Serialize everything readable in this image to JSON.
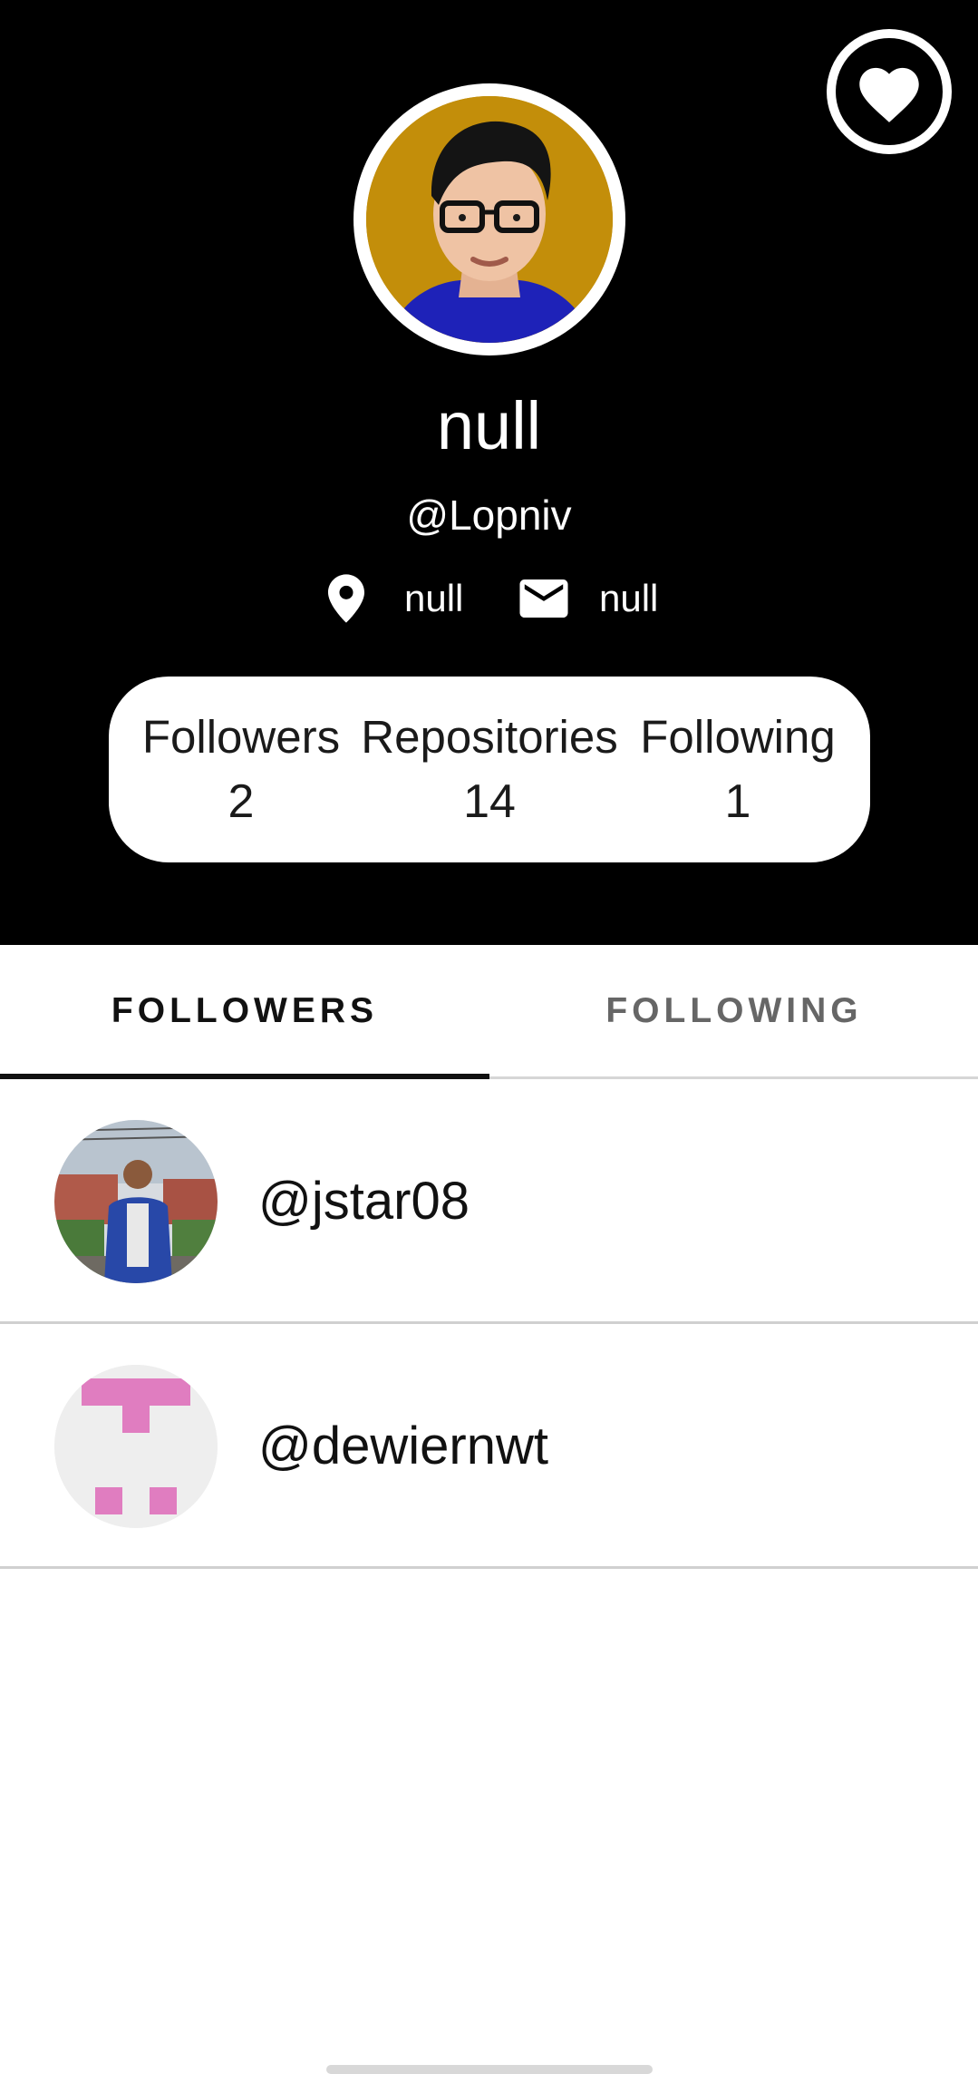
{
  "profile": {
    "name": "null",
    "login": "@Lopniv",
    "location": "null",
    "email": "null"
  },
  "stats": {
    "followers_label": "Followers",
    "followers_value": "2",
    "repositories_label": "Repositories",
    "repositories_value": "14",
    "following_label": "Following",
    "following_value": "1"
  },
  "tabs": {
    "followers": "FOLLOWERS",
    "following": "FOLLOWING",
    "selected": "FOLLOWERS"
  },
  "followers": [
    {
      "login": "@jstar08",
      "avatar": "photo-avatar"
    },
    {
      "login": "@dewiernwt",
      "avatar": "identicon-avatar"
    }
  ],
  "icons": {
    "favorite": "heart-icon",
    "location": "location-pin-icon",
    "email": "email-icon"
  },
  "colors": {
    "header_bg": "#000000",
    "avatar_bg": "#c38e0a",
    "identicon": "#e07dc0",
    "identicon_bg": "#eeeeee"
  }
}
